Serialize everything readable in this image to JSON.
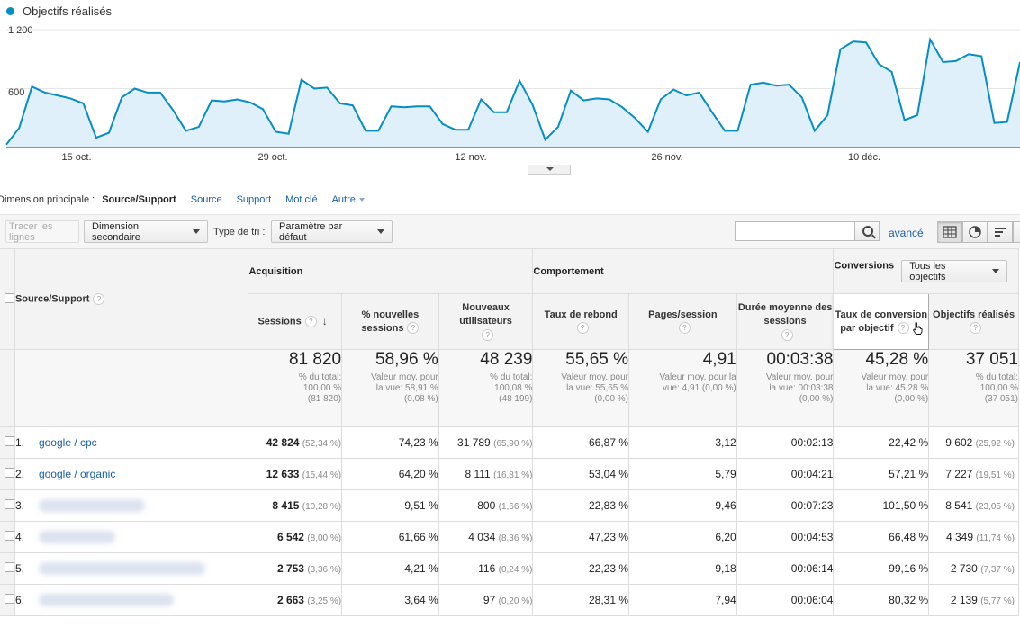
{
  "chart": {
    "legend_label": "Objectifs réalisés",
    "y_labels": [
      "1 200",
      "600"
    ],
    "x_labels": [
      "15 oct.",
      "29 oct.",
      "12 nov.",
      "26 nov.",
      "10 déc."
    ],
    "line_color": "#058dc7",
    "fill_color": "#e0f0fa"
  },
  "chart_data": {
    "type": "area",
    "series": [
      {
        "name": "Objectifs réalisés",
        "values": [
          30,
          200,
          620,
          560,
          530,
          500,
          450,
          100,
          150,
          510,
          600,
          560,
          560,
          380,
          170,
          210,
          480,
          470,
          490,
          460,
          390,
          160,
          140,
          690,
          600,
          610,
          450,
          430,
          170,
          170,
          420,
          410,
          420,
          420,
          240,
          180,
          180,
          490,
          360,
          360,
          680,
          440,
          80,
          210,
          580,
          480,
          500,
          490,
          410,
          300,
          160,
          490,
          590,
          530,
          560,
          360,
          170,
          170,
          640,
          660,
          630,
          640,
          510,
          170,
          330,
          1000,
          1080,
          1070,
          850,
          770,
          280,
          330,
          1100,
          870,
          880,
          950,
          930,
          250,
          260,
          870
        ]
      }
    ],
    "ylim": [
      0,
      1200
    ],
    "x_tick_labels": [
      "15 oct.",
      "29 oct.",
      "12 nov.",
      "26 nov.",
      "10 déc."
    ],
    "grid": true
  },
  "dimension_bar": {
    "label": "Dimension principale :",
    "current": "Source/Support",
    "links": [
      "Source",
      "Support",
      "Mot clé"
    ],
    "more": "Autre"
  },
  "toolbar": {
    "plot_rows": "Tracer les lignes",
    "secondary_dimension": "Dimension secondaire",
    "sort_type_label": "Type de tri :",
    "sort_type_value": "Paramètre par défaut",
    "search_value": "",
    "advanced": "avancé"
  },
  "table": {
    "dimension_header": "Source/Support",
    "groups": {
      "acquisition": "Acquisition",
      "behavior": "Comportement",
      "conversions": "Conversions",
      "goal_select": "Tous les objectifs"
    },
    "columns": {
      "sessions": "Sessions",
      "pct_new_sessions": "% nouvelles sessions",
      "new_users": "Nouveaux utilisateurs",
      "bounce_rate": "Taux de rebond",
      "pages_session": "Pages/session",
      "avg_duration": "Durée moyenne des sessions",
      "conv_rate": "Taux de conversion par objectif",
      "goals": "Objectifs réalisés"
    },
    "totals": {
      "sessions": {
        "v": "81 820",
        "s1": "% du total:",
        "s2": "100,00 %",
        "s3": "(81 820)"
      },
      "pct_new": {
        "v": "58,96 %",
        "s1": "Valeur moy. pour",
        "s2": "la vue: 58,91 %",
        "s3": "(0,08 %)"
      },
      "new_users": {
        "v": "48 239",
        "s1": "% du total:",
        "s2": "100,08 %",
        "s3": "(48 199)"
      },
      "bounce": {
        "v": "55,65 %",
        "s1": "Valeur moy. pour",
        "s2": "la vue: 55,65 %",
        "s3": "(0,00 %)"
      },
      "pages": {
        "v": "4,91",
        "s1": "Valeur moy. pour la",
        "s2": "vue: 4,91 (0,00 %)",
        "s3": ""
      },
      "duration": {
        "v": "00:03:38",
        "s1": "Valeur moy. pour",
        "s2": "la vue: 00:03:38",
        "s3": "(0,00 %)"
      },
      "conv": {
        "v": "45,28 %",
        "s1": "Valeur moy. pour",
        "s2": "la vue: 45,28 %",
        "s3": "(0,00 %)"
      },
      "goals": {
        "v": "37 051",
        "s1": "% du total:",
        "s2": "100,00 %",
        "s3": "(37 051)"
      }
    },
    "rows": [
      {
        "idx": "1.",
        "name": "google / cpc",
        "sessions": "42 824",
        "sessions_pct": "(52,34 %)",
        "pct_new": "74,23 %",
        "new_users": "31 789",
        "new_users_pct": "(65,90 %)",
        "bounce": "66,87 %",
        "pages": "3,12",
        "duration": "00:02:13",
        "conv": "22,42 %",
        "goals": "9 602",
        "goals_pct": "(25,92 %)"
      },
      {
        "idx": "2.",
        "name": "google / organic",
        "sessions": "12 633",
        "sessions_pct": "(15,44 %)",
        "pct_new": "64,20 %",
        "new_users": "8 111",
        "new_users_pct": "(16,81 %)",
        "bounce": "53,04 %",
        "pages": "5,79",
        "duration": "00:04:21",
        "conv": "57,21 %",
        "goals": "7 227",
        "goals_pct": "(19,51 %)"
      },
      {
        "idx": "3.",
        "name": "",
        "sessions": "8 415",
        "sessions_pct": "(10,28 %)",
        "pct_new": "9,51 %",
        "new_users": "800",
        "new_users_pct": "(1,66 %)",
        "bounce": "22,83 %",
        "pages": "9,46",
        "duration": "00:07:23",
        "conv": "101,50 %",
        "goals": "8 541",
        "goals_pct": "(23,05 %)"
      },
      {
        "idx": "4.",
        "name": "",
        "sessions": "6 542",
        "sessions_pct": "(8,00 %)",
        "pct_new": "61,66 %",
        "new_users": "4 034",
        "new_users_pct": "(8,36 %)",
        "bounce": "47,23 %",
        "pages": "6,20",
        "duration": "00:04:53",
        "conv": "66,48 %",
        "goals": "4 349",
        "goals_pct": "(11,74 %)"
      },
      {
        "idx": "5.",
        "name": "",
        "sessions": "2 753",
        "sessions_pct": "(3,36 %)",
        "pct_new": "4,21 %",
        "new_users": "116",
        "new_users_pct": "(0,24 %)",
        "bounce": "22,23 %",
        "pages": "9,18",
        "duration": "00:06:14",
        "conv": "99,16 %",
        "goals": "2 730",
        "goals_pct": "(7,37 %)"
      },
      {
        "idx": "6.",
        "name": "",
        "sessions": "2 663",
        "sessions_pct": "(3,25 %)",
        "pct_new": "3,64 %",
        "new_users": "97",
        "new_users_pct": "(0,20 %)",
        "bounce": "28,31 %",
        "pages": "7,94",
        "duration": "00:06:04",
        "conv": "80,32 %",
        "goals": "2 139",
        "goals_pct": "(5,77 %)"
      }
    ]
  }
}
